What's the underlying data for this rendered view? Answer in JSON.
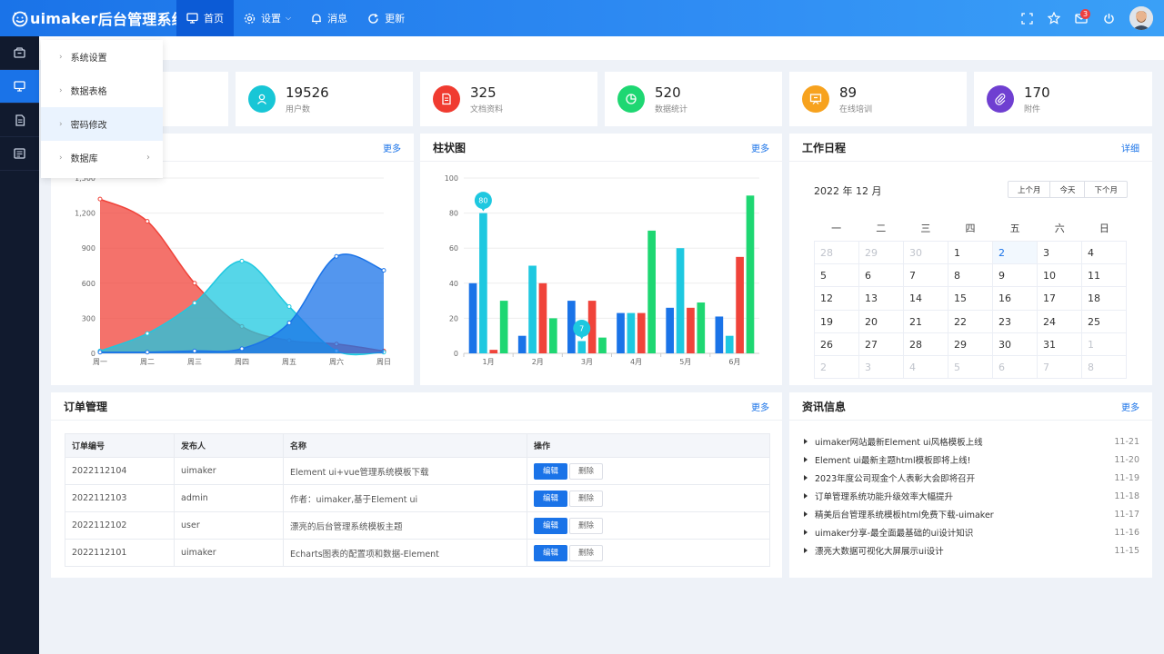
{
  "app": {
    "brand": "uimaker",
    "title": "后台管理系统"
  },
  "nav": [
    {
      "label": "首页",
      "icon": "monitor-icon",
      "active": true
    },
    {
      "label": "设置",
      "icon": "gear-icon",
      "dropdown": true
    },
    {
      "label": "消息",
      "icon": "bell-icon"
    },
    {
      "label": "更新",
      "icon": "refresh-icon"
    }
  ],
  "tools": {
    "mail_badge": "3"
  },
  "sidebar_icons": [
    "box-icon",
    "monitor-icon",
    "document-icon",
    "report-icon"
  ],
  "flyout": [
    {
      "label": "系统设置"
    },
    {
      "label": "数据表格"
    },
    {
      "label": "密码修改",
      "highlight": true
    },
    {
      "label": "数据库",
      "submenu": true
    }
  ],
  "stats": [
    {
      "value": "",
      "label": ""
    },
    {
      "value": "19526",
      "label": "用户数",
      "color": "#18c6d6",
      "icon": "user-icon"
    },
    {
      "value": "325",
      "label": "文档资料",
      "color": "#f03b30",
      "icon": "doc-icon"
    },
    {
      "value": "520",
      "label": "数据统计",
      "color": "#1ed772",
      "icon": "pie-icon"
    },
    {
      "value": "89",
      "label": "在线培训",
      "color": "#f7a21e",
      "icon": "board-icon"
    },
    {
      "value": "170",
      "label": "附件",
      "color": "#6f3fd1",
      "icon": "clip-icon"
    }
  ],
  "area_chart": {
    "more": "更多"
  },
  "bar_chart": {
    "title": "柱状图",
    "more": "更多"
  },
  "chart_data": [
    {
      "type": "area",
      "categories": [
        "周一",
        "周二",
        "周三",
        "周四",
        "周五",
        "周六",
        "周日"
      ],
      "ylim": [
        0,
        1500
      ],
      "yticks": [
        "0",
        "300",
        "600",
        "900",
        "1,200",
        "1,500"
      ],
      "series": [
        {
          "values": [
            1320,
            1130,
            600,
            230,
            110,
            80,
            20
          ],
          "color": "#f0433a"
        },
        {
          "values": [
            20,
            170,
            430,
            790,
            400,
            20,
            10
          ],
          "color": "#1ec8e0"
        },
        {
          "values": [
            10,
            10,
            20,
            40,
            260,
            830,
            710
          ],
          "color": "#1a73e8"
        }
      ]
    },
    {
      "type": "bar",
      "title": "柱状图",
      "categories": [
        "1月",
        "2月",
        "3月",
        "4月",
        "5月",
        "6月"
      ],
      "ylim": [
        0,
        100
      ],
      "yticks": [
        "0",
        "20",
        "40",
        "60",
        "80",
        "100"
      ],
      "series": [
        {
          "values": [
            40,
            10,
            30,
            23,
            26,
            21
          ],
          "color": "#1a73e8"
        },
        {
          "values": [
            80,
            50,
            7,
            23,
            60,
            10
          ],
          "color": "#1ec8e0"
        },
        {
          "values": [
            2,
            40,
            30,
            23,
            26,
            55
          ],
          "color": "#f0433a"
        },
        {
          "values": [
            30,
            20,
            9,
            70,
            29,
            90
          ],
          "color": "#1ed772"
        }
      ],
      "markers": [
        {
          "category": "1月",
          "value": "80"
        },
        {
          "category": "3月",
          "value": "7"
        }
      ]
    }
  ],
  "calendar": {
    "title": "工作日程",
    "more": "详细",
    "month_label": "2022 年 12 月",
    "buttons": [
      "上个月",
      "今天",
      "下个月"
    ],
    "weekdays": [
      "一",
      "二",
      "三",
      "四",
      "五",
      "六",
      "日"
    ],
    "weeks": [
      [
        "28",
        "29",
        "30",
        "1",
        "2",
        "3",
        "4"
      ],
      [
        "5",
        "6",
        "7",
        "8",
        "9",
        "10",
        "11"
      ],
      [
        "12",
        "13",
        "14",
        "15",
        "16",
        "17",
        "18"
      ],
      [
        "19",
        "20",
        "21",
        "22",
        "23",
        "24",
        "25"
      ],
      [
        "26",
        "27",
        "28",
        "29",
        "30",
        "31",
        "1"
      ],
      [
        "2",
        "3",
        "4",
        "5",
        "6",
        "7",
        "8"
      ]
    ]
  },
  "orders": {
    "title": "订单管理",
    "more": "更多",
    "columns": [
      "订单编号",
      "发布人",
      "名称",
      "操作"
    ],
    "edit": "编辑",
    "delete": "删除",
    "rows": [
      [
        "2022112104",
        "uimaker",
        "Element ui+vue管理系统模板下载"
      ],
      [
        "2022112103",
        "admin",
        "作者：uimaker,基于Element ui"
      ],
      [
        "2022112102",
        "user",
        "漂亮的后台管理系统模板主题"
      ],
      [
        "2022112101",
        "uimaker",
        "Echarts图表的配置项和数据-Element"
      ]
    ]
  },
  "news": {
    "title": "资讯信息",
    "more": "更多",
    "items": [
      {
        "text": "uimaker网站最新Element ui风格模板上线",
        "date": "11-21"
      },
      {
        "text": "Element ui最新主题html模板即将上线!",
        "date": "11-20"
      },
      {
        "text": "2023年度公司现金个人表彰大会即将召开",
        "date": "11-19"
      },
      {
        "text": "订单管理系统功能升级效率大幅提升",
        "date": "11-18"
      },
      {
        "text": "精美后台管理系统模板html免费下载-uimaker",
        "date": "11-17"
      },
      {
        "text": "uimaker分享-最全面最基础的ui设计知识",
        "date": "11-16"
      },
      {
        "text": "漂亮大数据可视化大屏展示ui设计",
        "date": "11-15"
      }
    ]
  }
}
